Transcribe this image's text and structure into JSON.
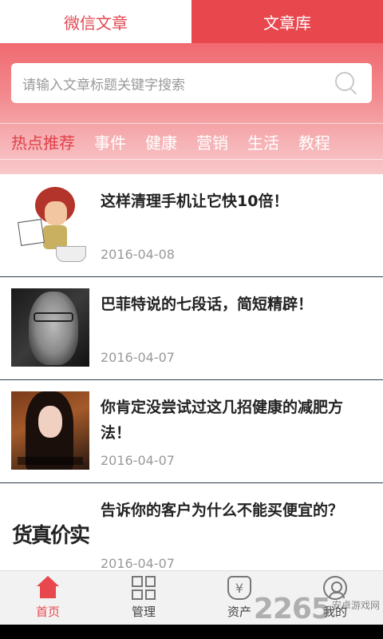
{
  "tabs": [
    {
      "label": "微信文章",
      "active": false
    },
    {
      "label": "文章库",
      "active": true
    }
  ],
  "search": {
    "placeholder": "请输入文章标题关键字搜索"
  },
  "categories": [
    "热点推荐",
    "事件",
    "健康",
    "营销",
    "生活",
    "教程"
  ],
  "selected_category": "热点推荐",
  "articles": [
    {
      "title": "这样清理手机让它快10倍！",
      "date": "2016-04-08",
      "thumb": "cartoon-toilet-image"
    },
    {
      "title": "巴菲特说的七段话，简短精辟！",
      "date": "2016-04-07",
      "thumb": "portrait-photo"
    },
    {
      "title": "你肯定没尝试过这几招健康的减肥方法！",
      "date": "2016-04-07",
      "thumb": "woman-photo"
    },
    {
      "title": "告诉你的客户为什么不能买便宜的？",
      "date": "2016-04-07",
      "thumb": "calligraphy-image",
      "thumb_text": "货真价实"
    }
  ],
  "navbar": [
    {
      "label": "首页",
      "icon": "home-icon",
      "active": true
    },
    {
      "label": "管理",
      "icon": "grid-icon",
      "active": false
    },
    {
      "label": "资产",
      "icon": "money-bag-icon",
      "symbol": "¥",
      "active": false
    },
    {
      "label": "我的",
      "icon": "user-icon",
      "active": false
    }
  ],
  "watermark": {
    "number": "2265",
    "text": "安卓游戏网"
  },
  "colors": {
    "accent": "#e8474e",
    "header_gradient_top": "#f06a70",
    "header_gradient_bottom": "#f8c8ca"
  }
}
